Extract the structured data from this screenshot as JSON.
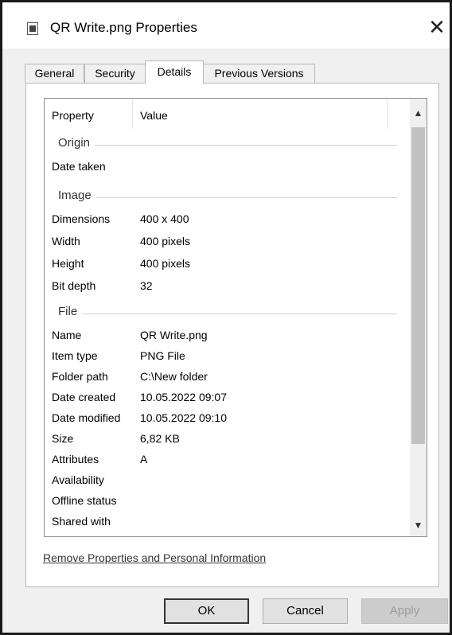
{
  "window": {
    "title": "QR Write.png Properties",
    "close_symbol": "✕"
  },
  "tabs": [
    {
      "label": "General"
    },
    {
      "label": "Security"
    },
    {
      "label": "Details"
    },
    {
      "label": "Previous Versions"
    }
  ],
  "active_tab": "Details",
  "details": {
    "columns": {
      "property": "Property",
      "value": "Value"
    },
    "groups": {
      "origin": {
        "label": "Origin",
        "rows": [
          {
            "key": "Date taken",
            "value": ""
          }
        ]
      },
      "image": {
        "label": "Image",
        "rows": [
          {
            "key": "Dimensions",
            "value": "400 x 400"
          },
          {
            "key": "Width",
            "value": "400 pixels"
          },
          {
            "key": "Height",
            "value": "400 pixels"
          },
          {
            "key": "Bit depth",
            "value": "32"
          }
        ]
      },
      "file": {
        "label": "File",
        "rows": [
          {
            "key": "Name",
            "value": "QR Write.png"
          },
          {
            "key": "Item type",
            "value": "PNG File"
          },
          {
            "key": "Folder path",
            "value": "C:\\New folder"
          },
          {
            "key": "Date created",
            "value": "10.05.2022 09:07"
          },
          {
            "key": "Date modified",
            "value": "10.05.2022 09:10"
          },
          {
            "key": "Size",
            "value": "6,82 KB"
          },
          {
            "key": "Attributes",
            "value": "A"
          },
          {
            "key": "Availability",
            "value": ""
          },
          {
            "key": "Offline status",
            "value": ""
          },
          {
            "key": "Shared with",
            "value": ""
          }
        ]
      }
    }
  },
  "remove_link": "Remove Properties and Personal Information",
  "buttons": {
    "ok": "OK",
    "cancel": "Cancel",
    "apply": "Apply"
  },
  "icons": {
    "title": "image-file-icon",
    "scroll_up": "chevron-up-icon",
    "scroll_down": "chevron-down-icon"
  }
}
